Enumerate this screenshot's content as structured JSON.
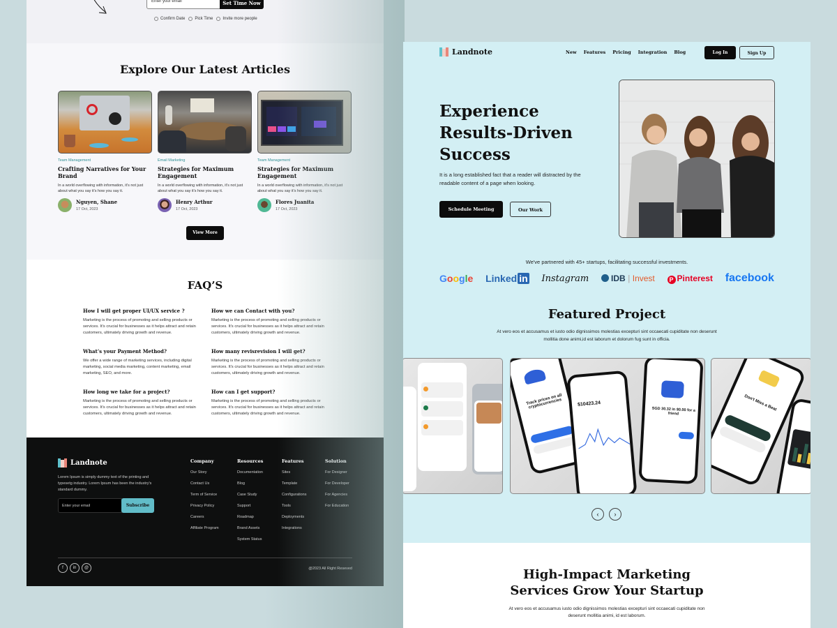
{
  "left_page": {
    "cta": {
      "email_placeholder": "Enter your email",
      "button_label": "Set Time Now",
      "checks": [
        "Confirm Date",
        "Pick Time",
        "Invite more people"
      ]
    },
    "articles": {
      "title": "Explore Our Latest Articles",
      "items": [
        {
          "category": "Team Management",
          "title": "Crafting Narratives for Your Brand",
          "desc": "In a world overflowing with information, it's not just about what you say it's how you say it.",
          "author": "Nguyen, Shane",
          "date": "17 Oct, 2023"
        },
        {
          "category": "Email Marketing",
          "title": "Strategies for Maximum Engagement",
          "desc": "In a world overflowing with information, it's not just about what you say it's how you say it.",
          "author": "Henry Arthur",
          "date": "17 Oct, 2023"
        },
        {
          "category": "Team Management",
          "title": "Strategies for Maximum Engagement",
          "desc": "In a world overflowing with information, it's not just about what you say it's how you say it.",
          "author": "Flores Juanita",
          "date": "17 Oct, 2023"
        }
      ],
      "view_more_label": "View More"
    },
    "faq": {
      "title": "FAQ’S",
      "items": [
        {
          "q": "How I will get proper UI/UX service ?",
          "a": "Marketing is the process of promoting and selling products or services. It's crucial for businesses as it helps attract and retain customers, ultimately driving growth and revenue."
        },
        {
          "q": "How we can Contact with you?",
          "a": "Marketing is the process of promoting and selling products or services. It's crucial for businesses as it helps attract and retain customers, ultimately driving growth and revenue."
        },
        {
          "q": "What’s  your Payment Method?",
          "a": "We offer a wide range of marketing services, including digital marketing, social media marketing, content marketing, email marketing, SEO, and more."
        },
        {
          "q": "How many revisrevision I will get?",
          "a": "Marketing is the process of promoting and selling products or services. It's crucial for businesses as it helps attract and retain customers, ultimately driving growth and revenue."
        },
        {
          "q": "How long we take for a project?",
          "a": "Marketing is the process of promoting and selling products or services. It's crucial for businesses as it helps attract and retain customers, ultimately driving growth and revenue."
        },
        {
          "q": "How can I get support?",
          "a": "Marketing is the process of promoting and selling products or services. It's crucial for businesses as it helps attract and retain customers, ultimately driving growth and revenue."
        }
      ]
    },
    "footer": {
      "brand": "Landnote",
      "desc": "Lorem Ipsum is simply dummy text of the printing and typesetg industry. Lorem Ipsum has been the industry's standard dummy.",
      "email_placeholder": "Enter your email",
      "subscribe_label": "Subscribe",
      "columns": [
        {
          "title": "Company",
          "links": [
            "Our Story",
            "Contact Us",
            "Term of Service",
            "Privacy Policy",
            "Careers",
            "Affiliate Program"
          ]
        },
        {
          "title": "Resources",
          "links": [
            "Documentation",
            "Blog",
            "Case Study",
            "Support",
            "Roadmap",
            "Brand Assets",
            "System Status"
          ]
        },
        {
          "title": "Features",
          "links": [
            "Sites",
            "Template",
            "Configurations",
            "Tools",
            "Deployments",
            "Integrations"
          ]
        },
        {
          "title": "Solution",
          "links": [
            "For Designer",
            "For Developer",
            "For Agencies",
            "For Education"
          ]
        }
      ],
      "social": [
        "f",
        "in",
        "@"
      ],
      "copyright": "@2023 All Right Reseved"
    }
  },
  "right_page": {
    "brand": "Landnote",
    "nav": [
      "New",
      "Features",
      "Pricing",
      "Integration",
      "Blog"
    ],
    "login_label": "Log In",
    "signup_label": "Sign Up",
    "hero": {
      "title_lines": [
        "Experience",
        "Results-Driven",
        "Success"
      ],
      "desc": "It is a long established fact that a reader will distracted by the readable content of a page when looking.",
      "primary_label": "Schedule Meeting",
      "secondary_label": "Our Work"
    },
    "partners": {
      "text": "We've partnered with 45+ startups, facilitating successful investments.",
      "logos": {
        "google": "Google",
        "linkedin": "Linked",
        "linkedin_in": "in",
        "instagram": "Instagram",
        "idb": "IDB",
        "idb_invest": "Invest",
        "pinterest": "Pinterest",
        "facebook": "facebook"
      }
    },
    "featured": {
      "title": "Featured Project",
      "desc": "At vero eos et accusamus et iusto odio dignissimos molestias  excepturi sint occaecati cupiditate non deserunt mollitia done  animi,id est laborum et dolorum fug sunt in officia.",
      "phone_texts": {
        "crypto_title": "Track prices on all cryptocurrencies",
        "balance": "$10423.24",
        "send": "SGD 30.32 in $0.00 for a friend",
        "dont_miss": "Don't Miss a Beat"
      },
      "prev_icon": "‹",
      "next_icon": "›"
    },
    "services": {
      "title_lines": [
        "High-Impact Marketing",
        "Services Grow Your Startup"
      ],
      "desc": "At vero eos et accusamus iusto odio dignissimos molestias excepturi sint occaecati cupiditate non deserunt mollitia animi, id est laborum."
    }
  }
}
